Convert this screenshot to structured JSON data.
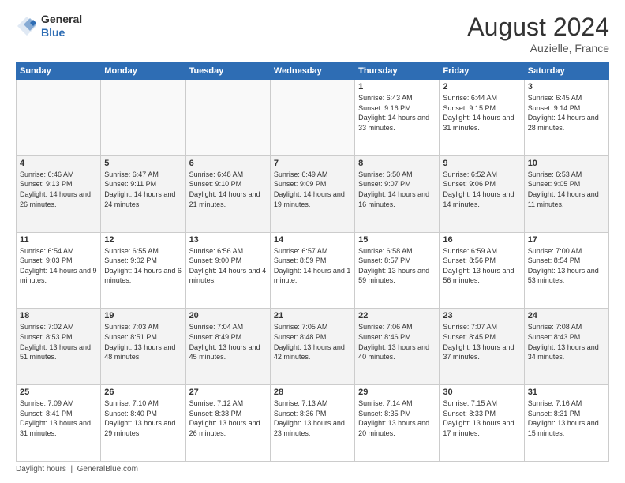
{
  "logo": {
    "general": "General",
    "blue": "Blue"
  },
  "header": {
    "month": "August 2024",
    "location": "Auzielle, France"
  },
  "weekdays": [
    "Sunday",
    "Monday",
    "Tuesday",
    "Wednesday",
    "Thursday",
    "Friday",
    "Saturday"
  ],
  "weeks": [
    [
      {
        "day": "",
        "info": "",
        "empty": true
      },
      {
        "day": "",
        "info": "",
        "empty": true
      },
      {
        "day": "",
        "info": "",
        "empty": true
      },
      {
        "day": "",
        "info": "",
        "empty": true
      },
      {
        "day": "1",
        "info": "Sunrise: 6:43 AM\nSunset: 9:16 PM\nDaylight: 14 hours\nand 33 minutes."
      },
      {
        "day": "2",
        "info": "Sunrise: 6:44 AM\nSunset: 9:15 PM\nDaylight: 14 hours\nand 31 minutes."
      },
      {
        "day": "3",
        "info": "Sunrise: 6:45 AM\nSunset: 9:14 PM\nDaylight: 14 hours\nand 28 minutes."
      }
    ],
    [
      {
        "day": "4",
        "info": "Sunrise: 6:46 AM\nSunset: 9:13 PM\nDaylight: 14 hours\nand 26 minutes."
      },
      {
        "day": "5",
        "info": "Sunrise: 6:47 AM\nSunset: 9:11 PM\nDaylight: 14 hours\nand 24 minutes."
      },
      {
        "day": "6",
        "info": "Sunrise: 6:48 AM\nSunset: 9:10 PM\nDaylight: 14 hours\nand 21 minutes."
      },
      {
        "day": "7",
        "info": "Sunrise: 6:49 AM\nSunset: 9:09 PM\nDaylight: 14 hours\nand 19 minutes."
      },
      {
        "day": "8",
        "info": "Sunrise: 6:50 AM\nSunset: 9:07 PM\nDaylight: 14 hours\nand 16 minutes."
      },
      {
        "day": "9",
        "info": "Sunrise: 6:52 AM\nSunset: 9:06 PM\nDaylight: 14 hours\nand 14 minutes."
      },
      {
        "day": "10",
        "info": "Sunrise: 6:53 AM\nSunset: 9:05 PM\nDaylight: 14 hours\nand 11 minutes."
      }
    ],
    [
      {
        "day": "11",
        "info": "Sunrise: 6:54 AM\nSunset: 9:03 PM\nDaylight: 14 hours\nand 9 minutes."
      },
      {
        "day": "12",
        "info": "Sunrise: 6:55 AM\nSunset: 9:02 PM\nDaylight: 14 hours\nand 6 minutes."
      },
      {
        "day": "13",
        "info": "Sunrise: 6:56 AM\nSunset: 9:00 PM\nDaylight: 14 hours\nand 4 minutes."
      },
      {
        "day": "14",
        "info": "Sunrise: 6:57 AM\nSunset: 8:59 PM\nDaylight: 14 hours\nand 1 minute."
      },
      {
        "day": "15",
        "info": "Sunrise: 6:58 AM\nSunset: 8:57 PM\nDaylight: 13 hours\nand 59 minutes."
      },
      {
        "day": "16",
        "info": "Sunrise: 6:59 AM\nSunset: 8:56 PM\nDaylight: 13 hours\nand 56 minutes."
      },
      {
        "day": "17",
        "info": "Sunrise: 7:00 AM\nSunset: 8:54 PM\nDaylight: 13 hours\nand 53 minutes."
      }
    ],
    [
      {
        "day": "18",
        "info": "Sunrise: 7:02 AM\nSunset: 8:53 PM\nDaylight: 13 hours\nand 51 minutes."
      },
      {
        "day": "19",
        "info": "Sunrise: 7:03 AM\nSunset: 8:51 PM\nDaylight: 13 hours\nand 48 minutes."
      },
      {
        "day": "20",
        "info": "Sunrise: 7:04 AM\nSunset: 8:49 PM\nDaylight: 13 hours\nand 45 minutes."
      },
      {
        "day": "21",
        "info": "Sunrise: 7:05 AM\nSunset: 8:48 PM\nDaylight: 13 hours\nand 42 minutes."
      },
      {
        "day": "22",
        "info": "Sunrise: 7:06 AM\nSunset: 8:46 PM\nDaylight: 13 hours\nand 40 minutes."
      },
      {
        "day": "23",
        "info": "Sunrise: 7:07 AM\nSunset: 8:45 PM\nDaylight: 13 hours\nand 37 minutes."
      },
      {
        "day": "24",
        "info": "Sunrise: 7:08 AM\nSunset: 8:43 PM\nDaylight: 13 hours\nand 34 minutes."
      }
    ],
    [
      {
        "day": "25",
        "info": "Sunrise: 7:09 AM\nSunset: 8:41 PM\nDaylight: 13 hours\nand 31 minutes."
      },
      {
        "day": "26",
        "info": "Sunrise: 7:10 AM\nSunset: 8:40 PM\nDaylight: 13 hours\nand 29 minutes."
      },
      {
        "day": "27",
        "info": "Sunrise: 7:12 AM\nSunset: 8:38 PM\nDaylight: 13 hours\nand 26 minutes."
      },
      {
        "day": "28",
        "info": "Sunrise: 7:13 AM\nSunset: 8:36 PM\nDaylight: 13 hours\nand 23 minutes."
      },
      {
        "day": "29",
        "info": "Sunrise: 7:14 AM\nSunset: 8:35 PM\nDaylight: 13 hours\nand 20 minutes."
      },
      {
        "day": "30",
        "info": "Sunrise: 7:15 AM\nSunset: 8:33 PM\nDaylight: 13 hours\nand 17 minutes."
      },
      {
        "day": "31",
        "info": "Sunrise: 7:16 AM\nSunset: 8:31 PM\nDaylight: 13 hours\nand 15 minutes."
      }
    ]
  ],
  "footer": {
    "text": "Daylight hours",
    "source": "GeneralBlue.com"
  }
}
